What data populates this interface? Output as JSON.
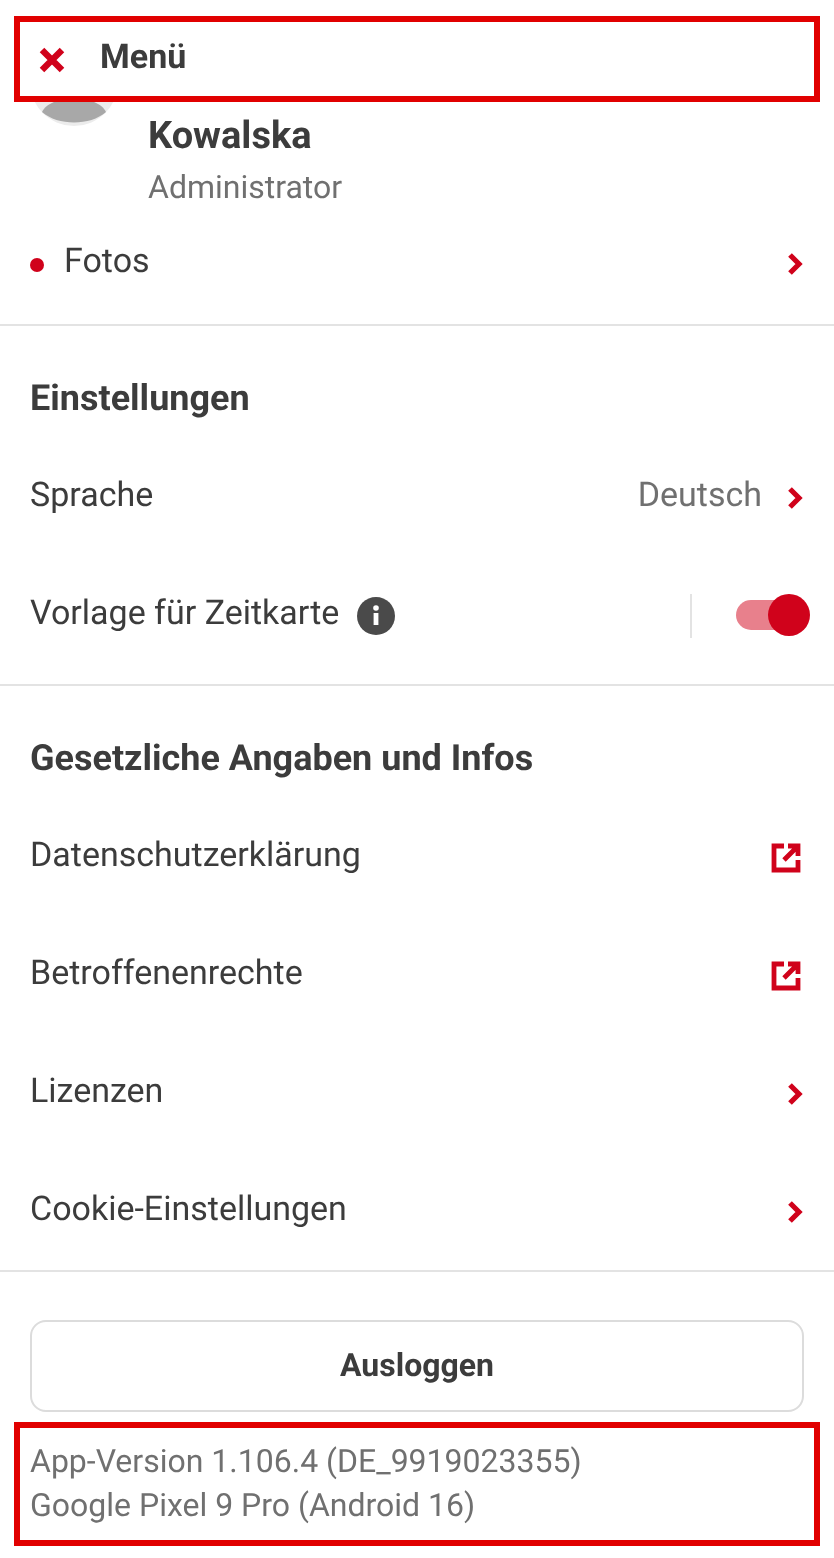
{
  "header": {
    "title": "Menü",
    "highlighted": true
  },
  "profile": {
    "name": "Kowalska",
    "role": "Administrator"
  },
  "profile_link": {
    "label": "Fotos",
    "unread": true
  },
  "sections": [
    {
      "title": "Einstellungen",
      "items": [
        {
          "kind": "value",
          "label": "Sprache",
          "value": "Deutsch"
        },
        {
          "kind": "toggle",
          "label": "Vorlage für Zeitkarte",
          "info": true,
          "on": true
        }
      ]
    },
    {
      "title": "Gesetzliche Angaben und Infos",
      "items": [
        {
          "kind": "external",
          "label": "Datenschutzerklärung"
        },
        {
          "kind": "external",
          "label": "Betroffenenrechte"
        },
        {
          "kind": "chevron",
          "label": "Lizenzen"
        },
        {
          "kind": "chevron",
          "label": "Cookie-Einstellungen"
        }
      ]
    }
  ],
  "logout_button": "Ausloggen",
  "footer": {
    "lines": [
      "App-Version 1.106.4 (DE_9919023355)",
      "Google Pixel 9 Pro (Android 16)"
    ],
    "highlighted": true
  }
}
